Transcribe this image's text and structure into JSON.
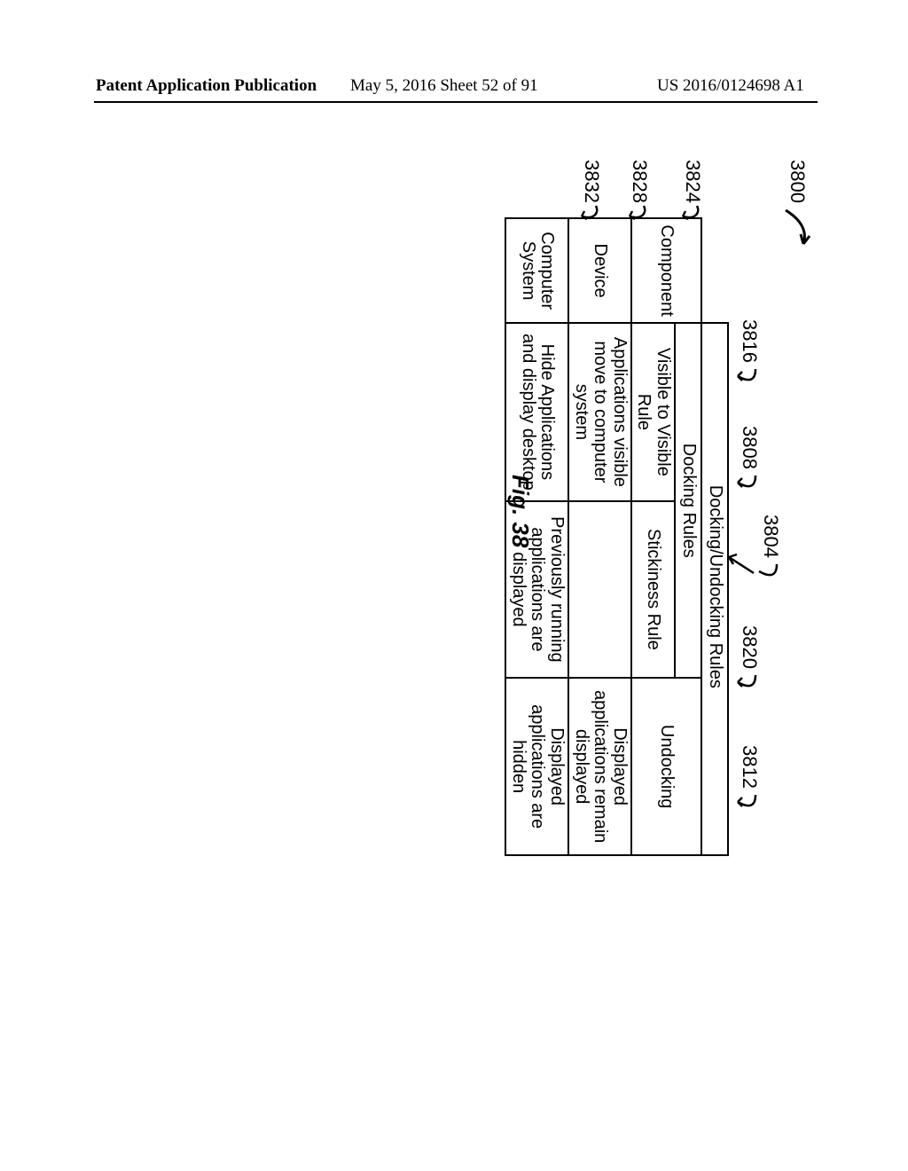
{
  "header": {
    "left": "Patent Application Publication",
    "center": "May 5, 2016  Sheet 52 of 91",
    "right": "US 2016/0124698 A1"
  },
  "refs": {
    "fig_tag": "3800",
    "r3804": "3804",
    "r3808": "3808",
    "r3812": "3812",
    "r3816": "3816",
    "r3820": "3820",
    "r3824": "3824",
    "r3828": "3828",
    "r3832": "3832"
  },
  "figure_caption": "Fig. 38",
  "table": {
    "super_header": "Docking/Undocking Rules",
    "col_component": "Component",
    "col_docking_rules": "Docking Rules",
    "sub_vis_rule": "Visible to Visible Rule",
    "sub_stick_rule": "Stickiness Rule",
    "col_undocking": "Undocking",
    "rows": [
      {
        "component": "Device",
        "docking_vis": "Applications visible move to computer system",
        "docking_stick": "",
        "undock": "Displayed applications remain displayed"
      },
      {
        "component": "Computer System",
        "docking_vis": "Hide Applications and display desktop",
        "docking_stick": "Previously running applications are displayed",
        "undock": "Displayed applications are hidden"
      }
    ]
  },
  "chart_data": {
    "type": "table",
    "title": "Docking/Undocking Rules",
    "columns": [
      "Component",
      "Visible to Visible Rule",
      "Stickiness Rule",
      "Undocking"
    ],
    "column_groups": {
      "Docking Rules": [
        "Visible to Visible Rule",
        "Stickiness Rule"
      ]
    },
    "rows": [
      [
        "Device",
        "Applications visible move to computer system",
        "",
        "Displayed applications remain displayed"
      ],
      [
        "Computer System",
        "Hide Applications and display desktop",
        "Previously running applications are displayed",
        "Displayed applications are hidden"
      ]
    ],
    "figure_number": "38",
    "reference_numerals": {
      "3800": "figure",
      "3804": "Docking/Undocking Rules header",
      "3808": "Docking Rules column group",
      "3812": "Undocking column",
      "3816": "Visible to Visible Rule column",
      "3820": "Stickiness Rule column",
      "3824": "Component row header",
      "3828": "Device row",
      "3832": "Computer System row"
    }
  }
}
